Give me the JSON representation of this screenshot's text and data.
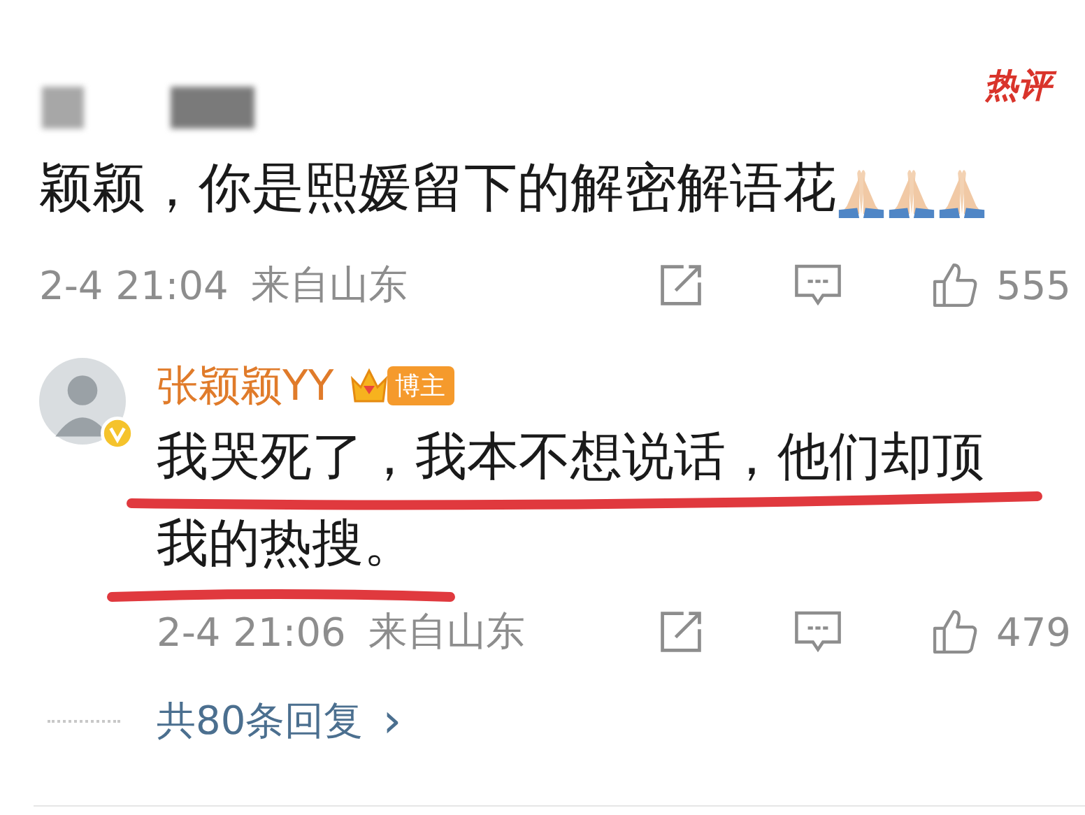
{
  "comment": {
    "badge": "热评",
    "text": "颖颖，你是熙媛留下的解密解语花",
    "time": "2-4 21:04",
    "location": "来自山东",
    "likes": "555"
  },
  "reply": {
    "author": "张颖颖YY",
    "author_badge": "博主",
    "text_lines": [
      "我哭死了，我本不想说话，他们却顶",
      "我的热搜。"
    ],
    "time": "2-4 21:06",
    "location": "来自山东",
    "likes": "479"
  },
  "more_replies": {
    "label": "共80条回复",
    "chevron": "›"
  }
}
